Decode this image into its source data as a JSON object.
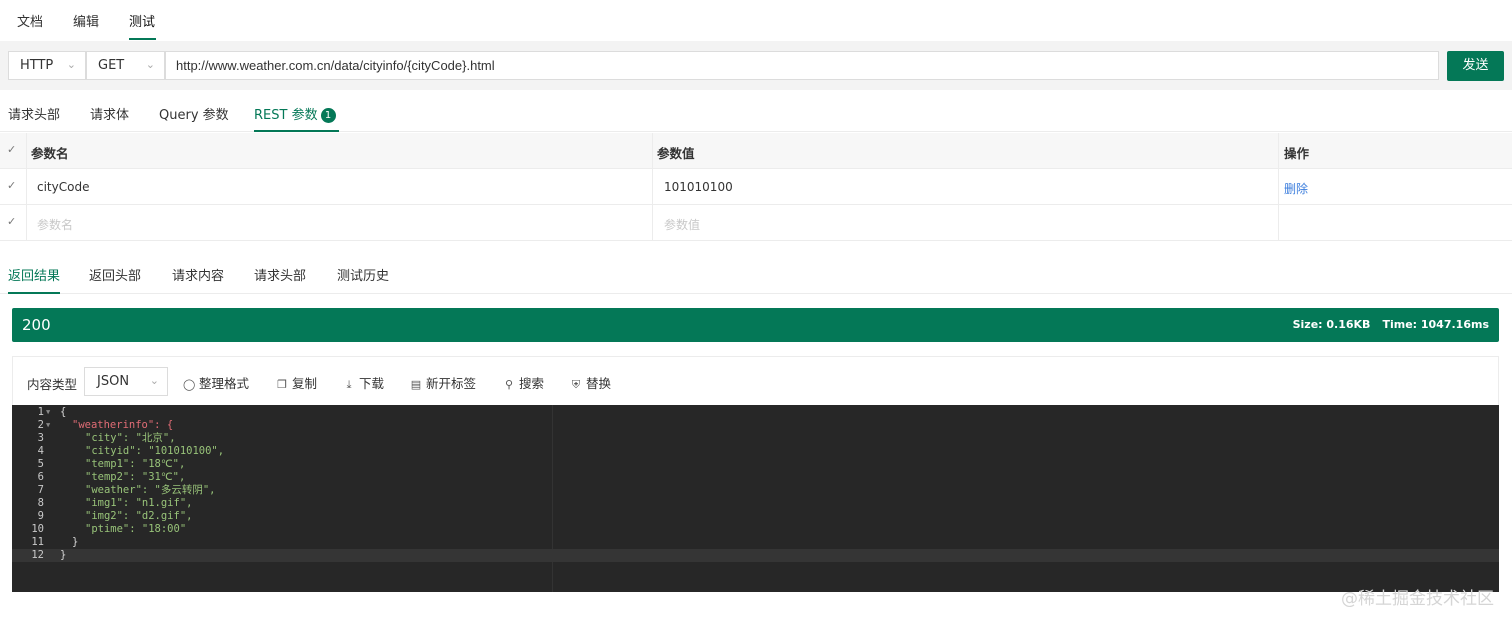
{
  "top_tabs": {
    "doc": "文档",
    "edit": "编辑",
    "test": "测试"
  },
  "request": {
    "protocol": "HTTP",
    "method": "GET",
    "url": "http://www.weather.com.cn/data/cityinfo/{cityCode}.html",
    "send_label": "发送"
  },
  "param_tabs": {
    "headers": "请求头部",
    "body": "请求体",
    "query": "Query 参数",
    "rest": "REST 参数",
    "rest_count": "1"
  },
  "param_table": {
    "col_name": "参数名",
    "col_value": "参数值",
    "col_action": "操作",
    "rows": [
      {
        "name": "cityCode",
        "value": "101010100",
        "action": "删除"
      }
    ],
    "placeholder_name": "参数名",
    "placeholder_value": "参数值"
  },
  "response_tabs": {
    "result": "返回结果",
    "headers": "返回头部",
    "req_content": "请求内容",
    "req_headers": "请求头部",
    "history": "测试历史"
  },
  "status": {
    "code": "200",
    "size": "Size: 0.16KB",
    "time": "Time: 1047.16ms"
  },
  "toolbar": {
    "content_type_label": "内容类型",
    "content_type": "JSON",
    "format": "整理格式",
    "copy": "复制",
    "download": "下载",
    "new_tab": "新开标签",
    "search": "搜索",
    "replace": "替换"
  },
  "code_lines": [
    "{",
    "\"weatherinfo\": {",
    "\"city\": \"北京\",",
    "\"cityid\": \"101010100\",",
    "\"temp1\": \"18℃\",",
    "\"temp2\": \"31℃\",",
    "\"weather\": \"多云转阴\",",
    "\"img1\": \"n1.gif\",",
    "\"img2\": \"d2.gif\",",
    "\"ptime\": \"18:00\"",
    "}",
    "}"
  ],
  "watermark": "@稀土掘金技术社区",
  "colors": {
    "accent": "#047857",
    "editor_bg": "#272727",
    "link": "#3b7ddd"
  }
}
